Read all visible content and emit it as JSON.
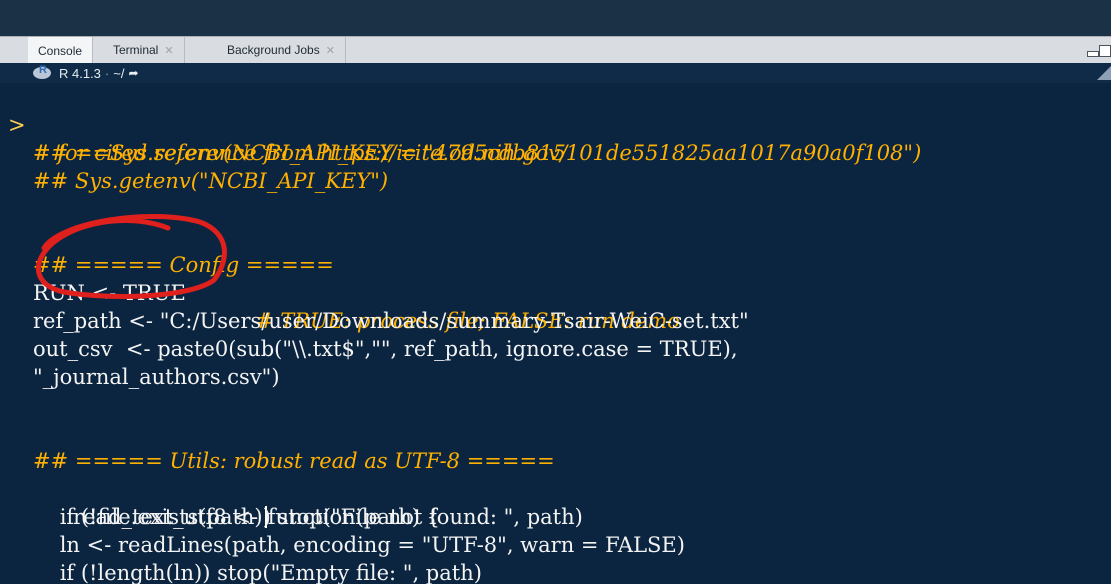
{
  "tabs": [
    {
      "label": "Console",
      "active": true
    },
    {
      "label": "Terminal",
      "closable": true
    },
    {
      "label": "Background Jobs",
      "closable": true
    }
  ],
  "info": {
    "r_version": "R 4.1.3",
    "separator": "·",
    "working_dir": "~/"
  },
  "console": {
    "prompt": ">",
    "lines": [
      "# for cited reference from https://icite.od.nih.gov/",
      "## ==Sys.setenv(NCBI_API_KEY = \"4795cdb815101de551825aa1017a90a0f108\")",
      "## Sys.getenv(\"NCBI_API_KEY\")",
      "",
      "## ===== Config =====",
      "RUN <- TRUE",
      "# TRUE: process file; FALSE: run demo",
      "ref_path <- \"C:/Users/user/Downloads/summary-Tsair-WeiC-set.txt\"",
      "out_csv  <- paste0(sub(\"\\\\.txt$\",\"\", ref_path, ignore.case = TRUE),",
      "\"_journal_authors.csv\")",
      "",
      "## ===== Utils: robust read as UTF-8 =====",
      "read_text_utf8 <- ",
      "function(path) {",
      "    if (!file.exists(path)) stop(\"File not found: \", path)",
      "    ln <- readLines(path, encoding = \"UTF-8\", warn = FALSE)",
      "    if (!length(ln)) stop(\"Empty file: \", path)"
    ]
  },
  "colors": {
    "background": "#0b2540",
    "comment": "#ffb000",
    "code": "#f4f4f4",
    "annotation_circle": "#e0201c"
  }
}
